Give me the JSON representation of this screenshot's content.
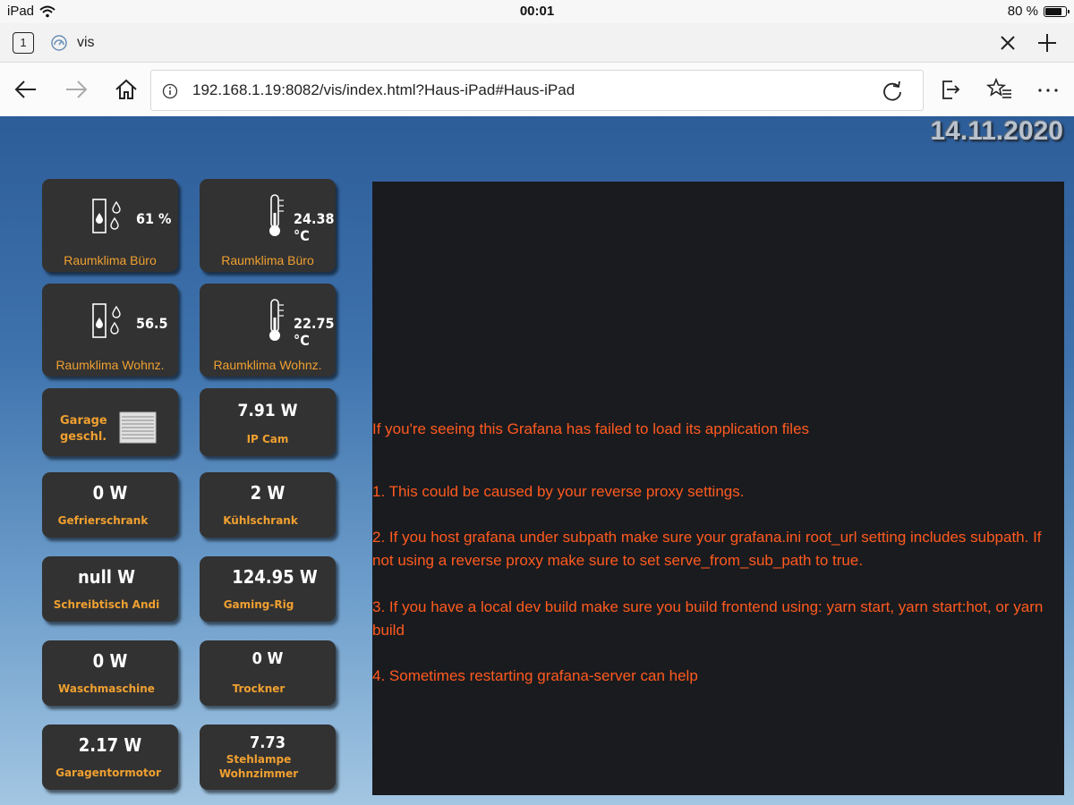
{
  "status_bar": {
    "device": "iPad",
    "time": "00:01",
    "battery_text": "80 %",
    "battery_level": 0.8
  },
  "browser": {
    "tab_count": "1",
    "tab_title": "vis",
    "url": "192.168.1.19:8082/vis/index.html?Haus-iPad#Haus-iPad",
    "icons": [
      "wifi-icon",
      "battery-icon",
      "close-icon",
      "plus-icon",
      "back-icon",
      "forward-icon",
      "home-icon",
      "info-icon",
      "reload-icon",
      "share-icon",
      "favorites-icon",
      "more-icon"
    ]
  },
  "dashboard": {
    "date": "14.11.2020",
    "climate": [
      {
        "value": "61 %",
        "label": "Raumklima Büro",
        "icon": "humidity-icon"
      },
      {
        "value": "24.38 °C",
        "label": "Raumklima Büro",
        "icon": "thermometer-icon"
      },
      {
        "value": "56.5",
        "label": "Raumklima Wohnz.",
        "icon": "humidity-icon"
      },
      {
        "value": "22.75 °C",
        "label": "Raumklima Wohnz.",
        "icon": "thermometer-icon"
      }
    ],
    "garage": {
      "label_line1": "Garage",
      "label_line2": "geschl.",
      "icon": "garage-door-icon"
    },
    "ipcam": {
      "value": "7.91 W",
      "label": "IP Cam"
    },
    "power": [
      {
        "value": "0 W",
        "label": "Gefrierschrank"
      },
      {
        "value": "2 W",
        "label": "Kühlschrank"
      },
      {
        "value": "null W",
        "label": "Schreibtisch Andi"
      },
      {
        "value": "124.95 W",
        "label": "Gaming-Rig"
      },
      {
        "value": "0 W",
        "label": "Waschmaschine"
      },
      {
        "value": "0 W",
        "label": "Trockner"
      },
      {
        "value": "2.17 W",
        "label": "Garagentormotor"
      },
      {
        "value": "7.73",
        "label_line1": "Stehlampe",
        "label_line2": "Wohnzimmer"
      }
    ],
    "grafana": {
      "headline": "If you're seeing this Grafana has failed to load its application files",
      "items": [
        "1. This could be caused by your reverse proxy settings.",
        "2. If you host grafana under subpath make sure your grafana.ini root_url setting includes subpath. If not using a reverse proxy make sure to set serve_from_sub_path to true.",
        "3. If you have a local dev build make sure you build frontend using: yarn start, yarn start:hot, or yarn build",
        "4. Sometimes restarting grafana-server can help"
      ]
    }
  }
}
